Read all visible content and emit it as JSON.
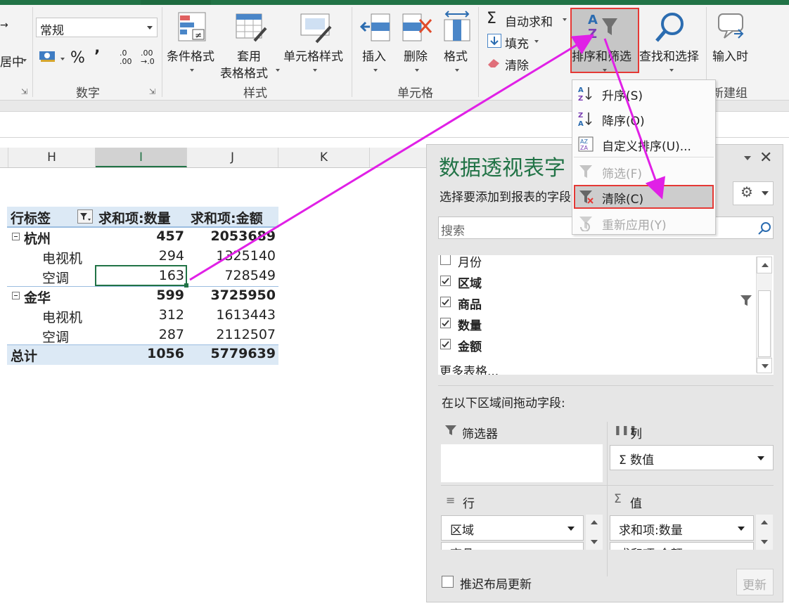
{
  "ribbon": {
    "partial_left_top": "→",
    "partial_left_mid": "居中",
    "number_format_value": "常规",
    "percent_symbol": "%",
    "comma_symbol": "’",
    "inc_decimal": ".0 .00",
    "dec_decimal": ".00 →.0",
    "group_number": "数字",
    "btn_conditional_format": "条件格式",
    "btn_table_format_1": "套用",
    "btn_table_format_2": "表格格式",
    "btn_cell_style": "单元格样式",
    "group_style": "样式",
    "btn_insert": "插入",
    "btn_delete": "删除",
    "btn_format": "格式",
    "group_cells": "单元格",
    "btn_autosum": "自动求和",
    "btn_fill": "填充",
    "btn_clear": "清除",
    "btn_sort_filter": "排序和筛选",
    "btn_find_select": "查找和选择",
    "btn_input": "输入时",
    "group_new": "新建组"
  },
  "sort_menu": {
    "items": [
      {
        "label": "升序(S)",
        "enabled": true
      },
      {
        "label": "降序(O)",
        "enabled": true
      },
      {
        "label": "自定义排序(U)...",
        "enabled": true
      },
      {
        "label": "筛选(F)",
        "enabled": false
      },
      {
        "label": "清除(C)",
        "enabled": true
      },
      {
        "label": "重新应用(Y)",
        "enabled": false
      }
    ]
  },
  "columns": [
    "H",
    "I",
    "J",
    "K"
  ],
  "pivot": {
    "header_label": "行标签",
    "header_qty": "求和项:数量",
    "header_amt": "求和项:金额",
    "rows": [
      {
        "label": "杭州",
        "qty": "457",
        "amt": "2053689",
        "level": 0
      },
      {
        "label": "电视机",
        "qty": "294",
        "amt": "1325140",
        "level": 1
      },
      {
        "label": "空调",
        "qty": "163",
        "amt": "728549",
        "level": 1
      },
      {
        "label": "金华",
        "qty": "599",
        "amt": "3725950",
        "level": 0
      },
      {
        "label": "电视机",
        "qty": "312",
        "amt": "1613443",
        "level": 1
      },
      {
        "label": "空调",
        "qty": "287",
        "amt": "2112507",
        "level": 1
      }
    ],
    "total_label": "总计",
    "total_qty": "1056",
    "total_amt": "5779639"
  },
  "panel": {
    "title": "数据透视表字",
    "subtitle": "选择要添加到报表的字段",
    "search_placeholder": "搜索",
    "fields": [
      {
        "label": "月份",
        "checked": false
      },
      {
        "label": "区域",
        "checked": true
      },
      {
        "label": "商品",
        "checked": true
      },
      {
        "label": "数量",
        "checked": true
      },
      {
        "label": "金额",
        "checked": true
      }
    ],
    "more_tables": "更多表格...",
    "drag_label": "在以下区域间拖动字段:",
    "area_filter": "筛选器",
    "area_columns": "列",
    "area_rows": "行",
    "area_values": "值",
    "columns_item": "Σ 数值",
    "rows_items": [
      "区域",
      "商品"
    ],
    "values_items": [
      "求和项:数量",
      "求和项:金额"
    ],
    "defer_label": "推迟布局更新",
    "update_btn": "更新"
  },
  "colors": {
    "accent_green": "#217346",
    "highlight_red": "#e53935",
    "arrow_magenta": "#e020e6",
    "pivot_header_bg": "#dce9f5",
    "panel_title": "#217346"
  }
}
